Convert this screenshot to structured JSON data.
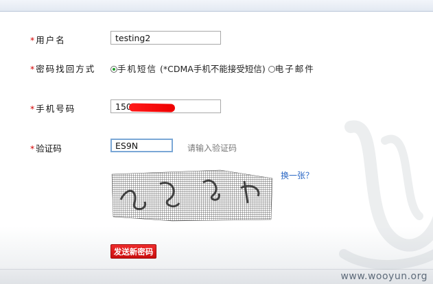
{
  "form": {
    "required_mark": "*",
    "username": {
      "label": "用户名",
      "value": "testing2"
    },
    "method": {
      "label": "密码找回方式",
      "options": [
        {
          "label": "手机短信",
          "note": "(*CDMA手机不能接受短信)",
          "checked": true
        },
        {
          "label": "电子邮件",
          "checked": false
        }
      ]
    },
    "phone": {
      "label": "手机号码",
      "value": "150"
    },
    "captcha": {
      "label": "验证码",
      "value": "ES9N",
      "hint": "请输入验证码",
      "refresh_label": "换一张？",
      "image_icon": "captcha-image"
    },
    "send_button": {
      "label": "发送新密码"
    }
  },
  "watermark": {
    "text": "www.wooyun.org"
  },
  "colors": {
    "required": "#d40000",
    "link": "#2a67c4",
    "button": "#d41a1a",
    "radio_checked": "#1e9c2a"
  }
}
